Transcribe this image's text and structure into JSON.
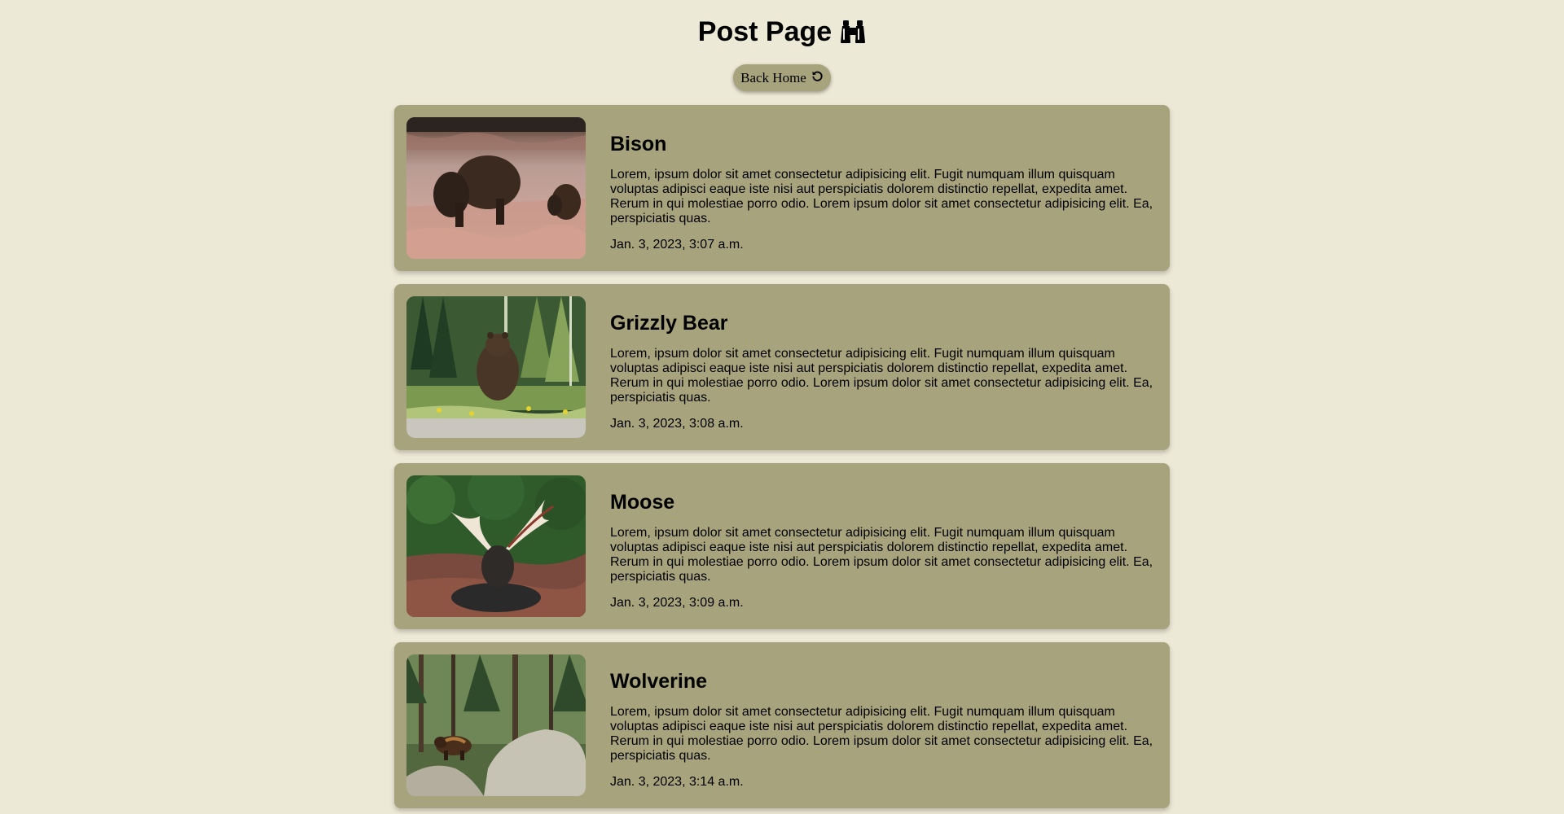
{
  "page": {
    "title": "Post Page",
    "title_icon": "binoculars-icon",
    "back_button": {
      "label": "Back Home",
      "icon": "rotate-left-icon"
    }
  },
  "colors": {
    "background": "#EDE9D7",
    "card": "#A7A37D"
  },
  "posts": [
    {
      "title": "Bison",
      "body": "Lorem, ipsum dolor sit amet consectetur adipisicing elit. Fugit numquam illum quisquam voluptas adipisci eaque iste nisi aut perspiciatis dolorem distinctio repellat, expedita amet. Rerum in qui molestiae porro odio. Lorem ipsum dolor sit amet consectetur adipisicing elit. Ea, perspiciatis quas.",
      "date": "Jan. 3, 2023, 3:07 a.m."
    },
    {
      "title": "Grizzly Bear",
      "body": "Lorem, ipsum dolor sit amet consectetur adipisicing elit. Fugit numquam illum quisquam voluptas adipisci eaque iste nisi aut perspiciatis dolorem distinctio repellat, expedita amet. Rerum in qui molestiae porro odio. Lorem ipsum dolor sit amet consectetur adipisicing elit. Ea, perspiciatis quas.",
      "date": "Jan. 3, 2023, 3:08 a.m."
    },
    {
      "title": "Moose",
      "body": "Lorem, ipsum dolor sit amet consectetur adipisicing elit. Fugit numquam illum quisquam voluptas adipisci eaque iste nisi aut perspiciatis dolorem distinctio repellat, expedita amet. Rerum in qui molestiae porro odio. Lorem ipsum dolor sit amet consectetur adipisicing elit. Ea, perspiciatis quas.",
      "date": "Jan. 3, 2023, 3:09 a.m."
    },
    {
      "title": "Wolverine",
      "body": "Lorem, ipsum dolor sit amet consectetur adipisicing elit. Fugit numquam illum quisquam voluptas adipisci eaque iste nisi aut perspiciatis dolorem distinctio repellat, expedita amet. Rerum in qui molestiae porro odio. Lorem ipsum dolor sit amet consectetur adipisicing elit. Ea, perspiciatis quas.",
      "date": "Jan. 3, 2023, 3:14 a.m."
    }
  ]
}
